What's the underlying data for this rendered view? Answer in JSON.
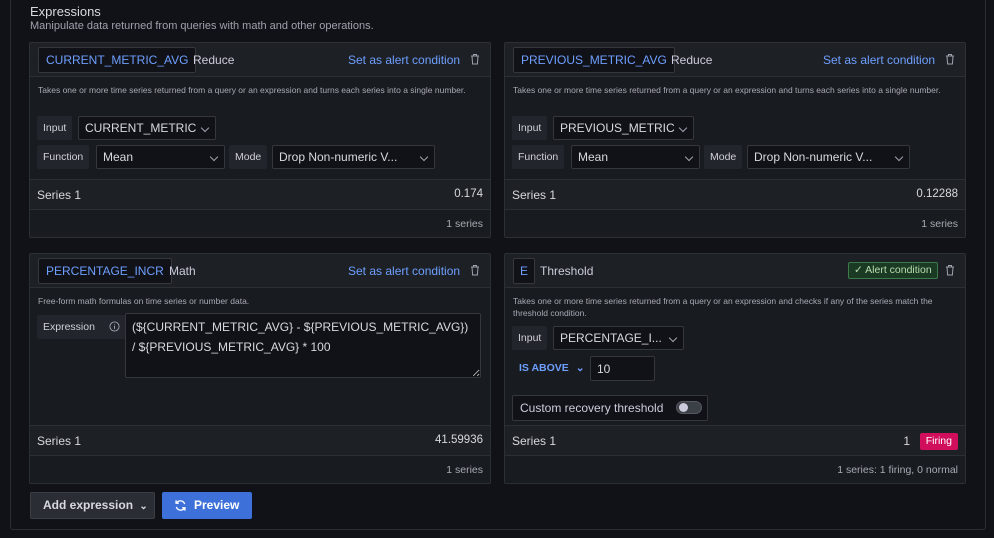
{
  "section": {
    "title": "Expressions",
    "description": "Manipulate data returned from queries with math and other operations."
  },
  "labels": {
    "set_alert": "Set as alert condition",
    "input": "Input",
    "function": "Function",
    "mode": "Mode",
    "expression": "Expression"
  },
  "card_a": {
    "ref_id": "CURRENT_METRIC_AVG",
    "type": "Reduce",
    "description": "Takes one or more time series returned from a query or an expression and turns each series into a single number.",
    "input_value": "CURRENT_METRIC",
    "function_value": "Mean",
    "mode_value": "Drop Non-numeric V...",
    "series_name": "Series 1",
    "series_value": "0.174",
    "series_count": "1 series"
  },
  "card_b": {
    "ref_id": "PREVIOUS_METRIC_AVG",
    "type": "Reduce",
    "description": "Takes one or more time series returned from a query or an expression and turns each series into a single number.",
    "input_value": "PREVIOUS_METRIC",
    "function_value": "Mean",
    "mode_value": "Drop Non-numeric V...",
    "series_name": "Series 1",
    "series_value": "0.12288",
    "series_count": "1 series"
  },
  "card_c": {
    "ref_id": "PERCENTAGE_INCR",
    "type": "Math",
    "description": "Free-form math formulas on time series or number data.",
    "expression": "(${CURRENT_METRIC_AVG} - ${PREVIOUS_METRIC_AVG}) / ${PREVIOUS_METRIC_AVG} * 100",
    "series_name": "Series 1",
    "series_value": "41.59936",
    "series_count": "1 series"
  },
  "card_d": {
    "ref_id": "E",
    "type": "Threshold",
    "alert_badge": "Alert condition",
    "description": "Takes one or more time series returned from a query or an expression and checks if any of the series match the threshold condition.",
    "input_value": "PERCENTAGE_I...",
    "condition": "IS ABOVE",
    "threshold_value": "10",
    "recovery_label": "Custom recovery threshold",
    "recovery_enabled": false,
    "series_name": "Series 1",
    "series_value": "1",
    "series_state": "Firing",
    "series_count": "1 series: 1 firing, 0 normal"
  },
  "actions": {
    "add_expression": "Add expression",
    "preview": "Preview"
  },
  "colors": {
    "link": "#6e9fff",
    "primary": "#3d71d9",
    "firing": "#d10e5c",
    "alert_badge": "#3d7a49"
  }
}
